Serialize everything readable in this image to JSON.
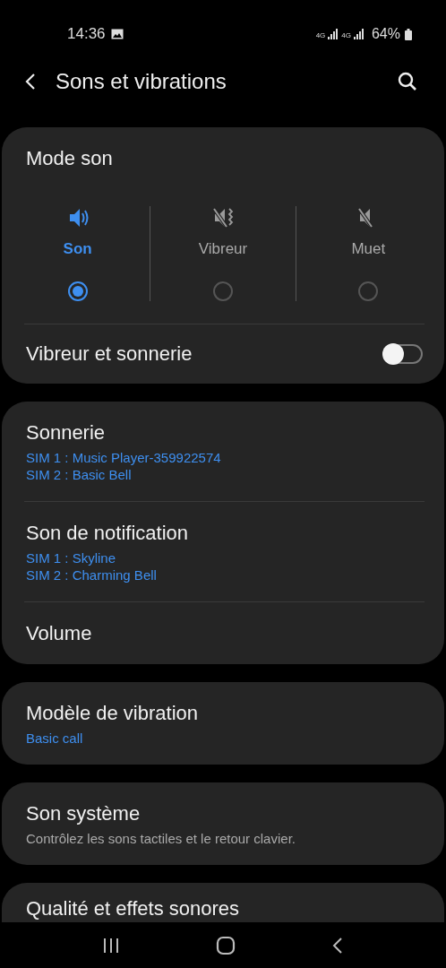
{
  "status_bar": {
    "time": "14:36",
    "network_1": "4G",
    "network_2": "4G",
    "battery": "64%"
  },
  "header": {
    "title": "Sons et vibrations"
  },
  "sound_mode": {
    "title": "Mode son",
    "modes": [
      {
        "kind": "sound",
        "label": "Son",
        "selected": true
      },
      {
        "kind": "vibrate",
        "label": "Vibreur",
        "selected": false
      },
      {
        "kind": "mute",
        "label": "Muet",
        "selected": false
      }
    ],
    "toggle": {
      "label": "Vibreur et sonnerie",
      "on": false
    }
  },
  "groups": [
    [
      {
        "title": "Sonnerie",
        "details": [
          "SIM 1 : Music Player-359922574",
          "SIM 2 : Basic Bell"
        ]
      },
      {
        "title": "Son de notification",
        "details": [
          "SIM 1 : Skyline",
          "SIM 2 : Charming Bell"
        ]
      },
      {
        "title": "Volume"
      }
    ],
    [
      {
        "title": "Modèle de vibration",
        "details": [
          "Basic call"
        ]
      }
    ],
    [
      {
        "title": "Son système",
        "description": "Contrôlez les sons tactiles et le retour clavier."
      }
    ],
    [
      {
        "title": "Qualité et effets sonores"
      }
    ]
  ]
}
